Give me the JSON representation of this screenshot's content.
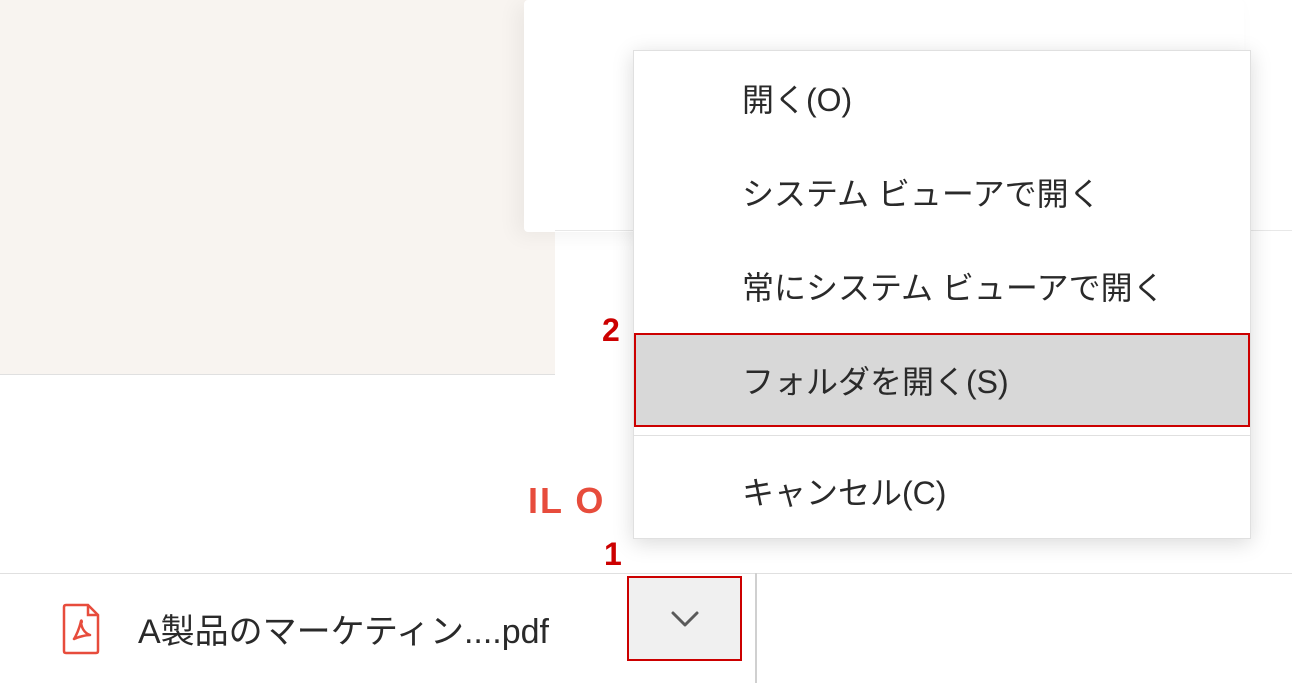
{
  "download": {
    "filename": "A製品のマーケティン....pdf"
  },
  "contextMenu": {
    "items": {
      "open": "開く(O)",
      "openSystemViewer": "システム ビューアで開く",
      "alwaysOpenSystemViewer": "常にシステム ビューアで開く",
      "openFolder": "フォルダを開く(S)",
      "cancel": "キャンセル(C)"
    }
  },
  "annotations": {
    "label1": "1",
    "label2": "2"
  },
  "fragment": {
    "text": "IL O"
  },
  "colors": {
    "highlight": "#cc0000",
    "menuHighlight": "#d8d8d8"
  }
}
